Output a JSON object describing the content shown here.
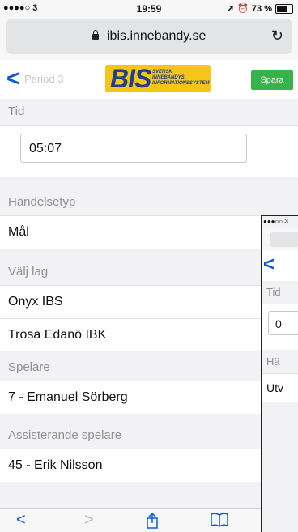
{
  "status_bar": {
    "carrier": "●●●●○ 3",
    "time": "19:59",
    "battery": "73 %",
    "battery_level": 0.73
  },
  "browser": {
    "url": "ibis.innebandy.se"
  },
  "header": {
    "back_label": "<",
    "ghost_label": "Period 3",
    "logo_main": "BIS",
    "logo_sub": "SVENSK\nINNEBANDYS\nINFORMATIONSSYSTEM",
    "save_label": "Spara"
  },
  "form": {
    "time": {
      "label": "Tid",
      "value": "05:07"
    },
    "event_type": {
      "label": "Händelsetyp",
      "value": "Mål"
    },
    "team": {
      "label": "Välj lag",
      "options": [
        {
          "name": "Onyx IBS",
          "selected": true
        },
        {
          "name": "Trosa Edanö IBK",
          "selected": false
        }
      ]
    },
    "player": {
      "label": "Spelare",
      "value": "7 - Emanuel Sörberg"
    },
    "assist": {
      "label": "Assisterande spelare",
      "value": "45 - Erik Nilsson"
    }
  },
  "toolbar": {
    "back": "<",
    "forward": ">",
    "share_icon": "share-icon",
    "bookmarks_icon": "book-icon"
  },
  "overlay": {
    "status": "●●●○○ 3",
    "back": "<",
    "time_label": "Tid",
    "time_value": "0",
    "event_label": "Hä",
    "event_value": "Utv"
  }
}
